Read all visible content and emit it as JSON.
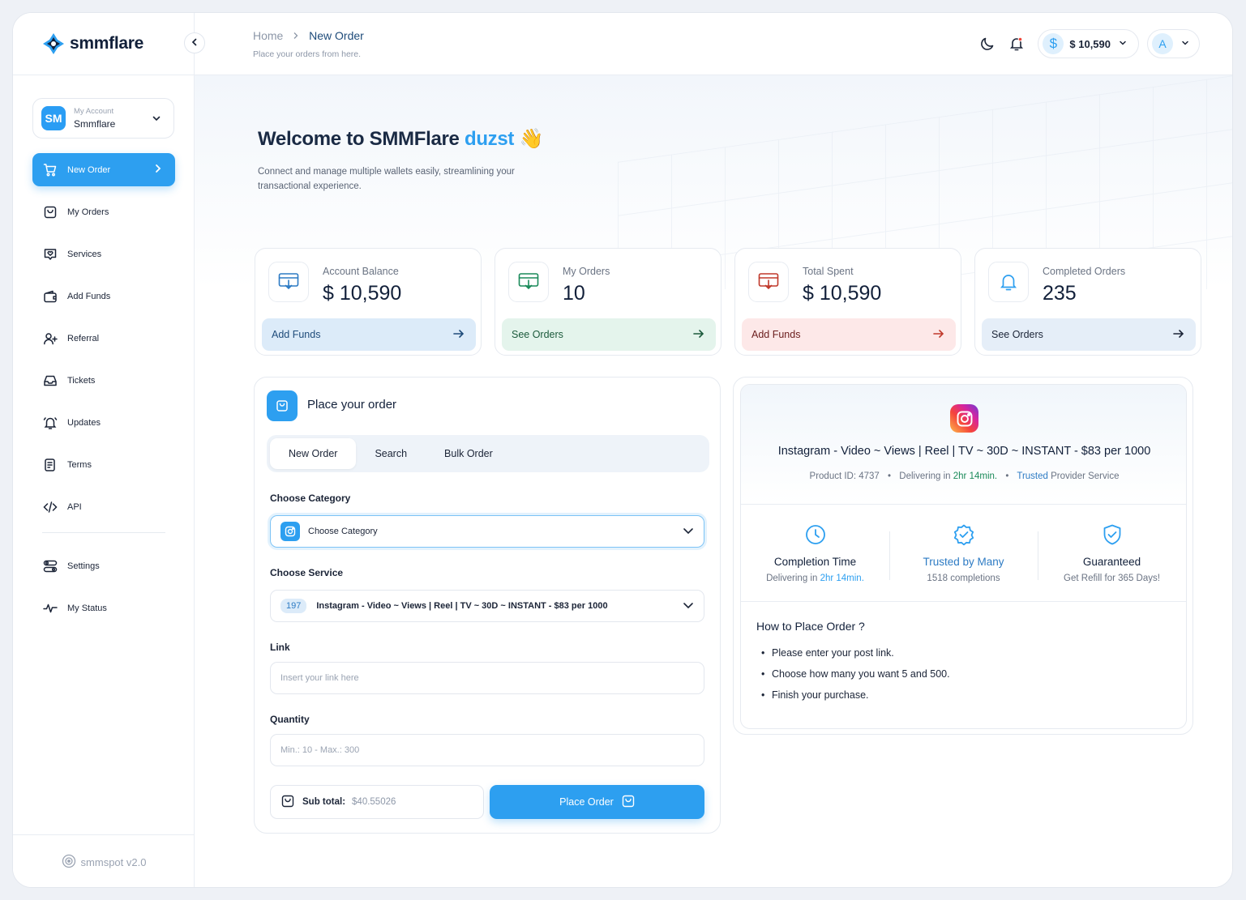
{
  "brand": {
    "name": "smmflare",
    "version": "smmspot v2.0"
  },
  "account": {
    "label": "My Account",
    "name": "Smmflare",
    "initials": "SM"
  },
  "sidebar": {
    "items": [
      {
        "label": "New Order",
        "icon": "cart-icon",
        "active": true
      },
      {
        "label": "My Orders",
        "icon": "bag-icon"
      },
      {
        "label": "Services",
        "icon": "heart-chat-icon"
      },
      {
        "label": "Add Funds",
        "icon": "wallet-icon"
      },
      {
        "label": "Referral",
        "icon": "user-plus-icon"
      },
      {
        "label": "Tickets",
        "icon": "inbox-icon"
      },
      {
        "label": "Updates",
        "icon": "bell-ring-icon"
      },
      {
        "label": "Terms",
        "icon": "document-icon"
      },
      {
        "label": "API",
        "icon": "code-icon"
      }
    ],
    "bottom_items": [
      {
        "label": "Settings",
        "icon": "toggles-icon"
      },
      {
        "label": "My Status",
        "icon": "activity-icon"
      }
    ]
  },
  "header": {
    "breadcrumb": {
      "home": "Home",
      "current": "New Order"
    },
    "subtitle": "Place your orders from here.",
    "balance": "$ 10,590",
    "balance_symbol": "$",
    "avatar_initial": "A"
  },
  "hero": {
    "title": "Welcome to SMMFlare ",
    "username": "duzst",
    "emoji": "👋",
    "subtitle": "Connect and manage multiple wallets easily, streamlining your transactional experience."
  },
  "stats": [
    {
      "label": "Account Balance",
      "value": "$ 10,590",
      "button": "Add Funds",
      "color": "#2d7bc4"
    },
    {
      "label": "My Orders",
      "value": "10",
      "button": "See Orders",
      "color": "#1b8a5a"
    },
    {
      "label": "Total Spent",
      "value": "$ 10,590",
      "button": "Add Funds",
      "color": "#c0392b"
    },
    {
      "label": "Completed Orders",
      "value": "235",
      "button": "See Orders",
      "color": "#2d9ff0"
    }
  ],
  "order": {
    "title": "Place your order",
    "tabs": [
      "New Order",
      "Search",
      "Bulk Order"
    ],
    "category_label": "Choose Category",
    "category_value": "Choose Category",
    "service_label": "Choose Service",
    "service_id": "197",
    "service_name": "Instagram - Video ~ Views | Reel | TV ~  30D ~ INSTANT -  $83 per 1000",
    "link_label": "Link",
    "link_placeholder": "Insert your link here",
    "quantity_label": "Quantity",
    "quantity_placeholder": "Min.: 10 - Max.: 300",
    "subtotal_label": "Sub total:",
    "subtotal_value": "$40.55026",
    "submit_label": "Place Order"
  },
  "info": {
    "title": "Instagram - Video ~ Views | Reel | TV ~  30D ~ INSTANT -  $83 per 1000",
    "product_id": "Product ID: 4737",
    "delivering_prefix": "Delivering in ",
    "delivering_time": "2hr 14min.",
    "trusted": "Trusted",
    "provider": " Provider Service",
    "features": [
      {
        "title": "Completion Time",
        "sub_prefix": "Delivering in ",
        "sub_highlight": "2hr 14min."
      },
      {
        "title": "Trusted by Many",
        "sub": "1518 completions"
      },
      {
        "title": "Guaranteed",
        "sub": "Get Refill for 365 Days!"
      }
    ],
    "howto_title": "How to Place Order ?",
    "howto_steps": [
      "Please enter your post link.",
      "Choose how many you want 5 and 500.",
      "Finish your purchase."
    ]
  },
  "colors": {
    "accent": "#2d9ff0",
    "text": "#12203a",
    "muted": "#8d97a8"
  }
}
